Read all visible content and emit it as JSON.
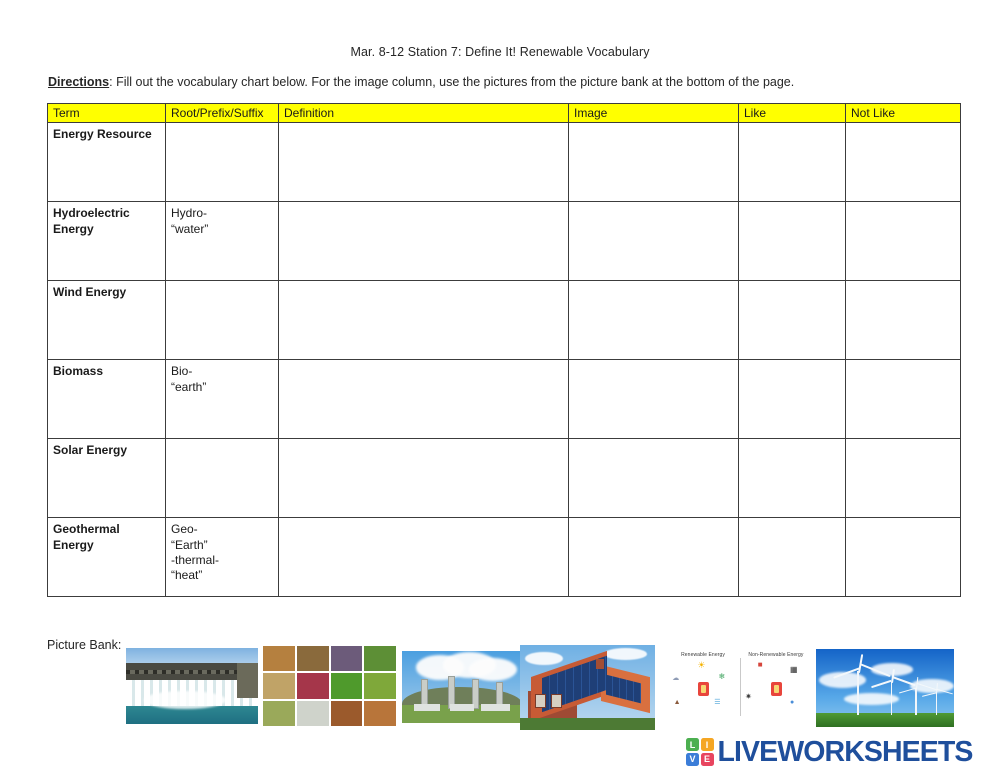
{
  "page": {
    "title": "Mar. 8-12 Station 7: Define It! Renewable Vocabulary",
    "directions_label": "Directions",
    "directions_text": ": Fill out the vocabulary chart below. For the image column, use the pictures from the picture bank at the bottom of the page."
  },
  "table": {
    "header_bg": "#ffff00",
    "columns": [
      "Term",
      "Root/Prefix/Suffix",
      "Definition",
      "Image",
      "Like",
      "Not Like"
    ],
    "rows": [
      {
        "term": "Energy Resource",
        "root": "",
        "definition": "",
        "image": "",
        "like": "",
        "not_like": ""
      },
      {
        "term": "Hydroelectric Energy",
        "root": "Hydro-\n“water”",
        "definition": "",
        "image": "",
        "like": "",
        "not_like": ""
      },
      {
        "term": "Wind Energy",
        "root": "",
        "definition": "",
        "image": "",
        "like": "",
        "not_like": ""
      },
      {
        "term": "Biomass",
        "root": "Bio-\n“earth”",
        "definition": "",
        "image": "",
        "like": "",
        "not_like": ""
      },
      {
        "term": "Solar Energy",
        "root": "",
        "definition": "",
        "image": "",
        "like": "",
        "not_like": ""
      },
      {
        "term": "Geothermal Energy",
        "root": "Geo-\n“Earth”\n-thermal-\n“heat”",
        "definition": "",
        "image": "",
        "like": "",
        "not_like": ""
      }
    ]
  },
  "picture_bank": {
    "label": "Picture Bank:",
    "images": [
      {
        "name": "hydroelectric-dam",
        "alt": "Hydroelectric dam with water spilling through many gates"
      },
      {
        "name": "biomass-collage",
        "alt": "Grid of biomass materials: logs, soil, grains, grass, corn, crops"
      },
      {
        "name": "geothermal-power-plant",
        "alt": "Geothermal power plant with steam rising from stacks"
      },
      {
        "name": "solar-panel-house",
        "alt": "Brick house with solar panels on the roof"
      },
      {
        "name": "renewable-vs-nonrenewable-diagram",
        "alt": "Diagram comparing renewable and non-renewable energy"
      },
      {
        "name": "wind-turbine-farm",
        "alt": "Wind turbines in a green field under a blue sky"
      }
    ],
    "diagram": {
      "left_title": "Renewable Energy",
      "right_title": "Non-Renewable Energy"
    }
  },
  "logo": {
    "tiles": [
      {
        "letter": "L",
        "color": "#4caf50"
      },
      {
        "letter": "I",
        "color": "#f5a623"
      },
      {
        "letter": "V",
        "color": "#3b7dd8"
      },
      {
        "letter": "E",
        "color": "#e8455f"
      }
    ],
    "wordmark": "LIVEWORKSHEETS",
    "wordmark_color": "#1f4f9c"
  }
}
